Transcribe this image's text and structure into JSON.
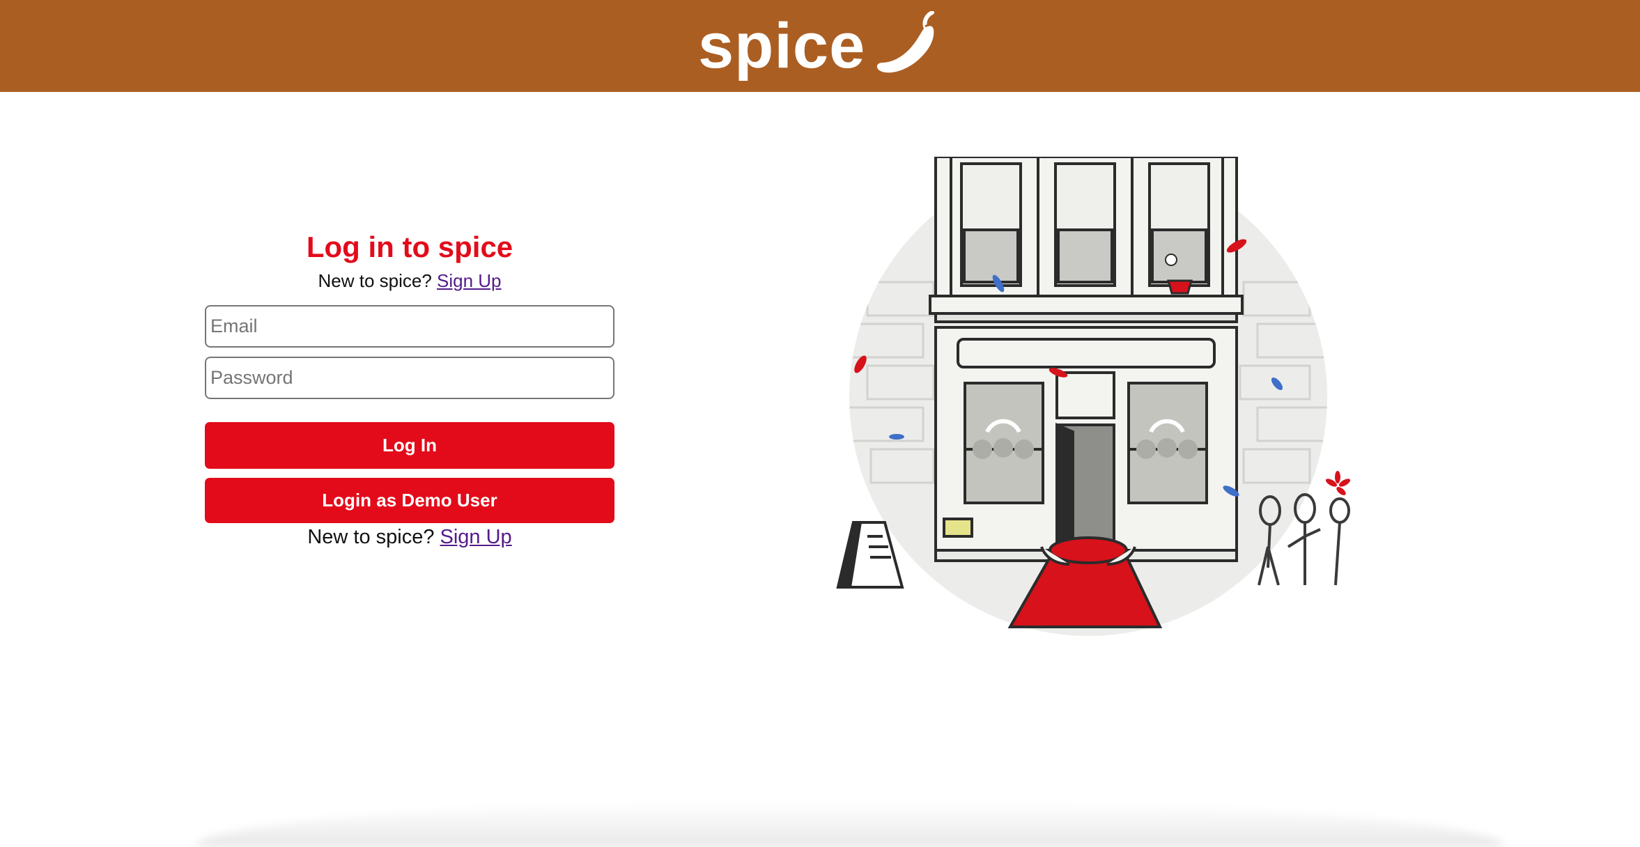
{
  "header": {
    "brand_name": "spice",
    "brand_icon": "chili-pepper-icon",
    "background_color": "#ab5e22"
  },
  "login": {
    "title": "Log in to spice",
    "signup_prompt_top": "New to spice? ",
    "signup_link_top": "Sign Up",
    "email_placeholder": "Email",
    "email_value": "",
    "password_placeholder": "Password",
    "password_value": "",
    "login_button": "Log In",
    "demo_button": "Login as Demo User",
    "signup_prompt_bottom": "New to spice? ",
    "signup_link_bottom": "Sign Up",
    "accent_color": "#e30b1a",
    "link_color": "#551a8b"
  },
  "illustration": {
    "icon": "restaurant-storefront-illustration"
  }
}
